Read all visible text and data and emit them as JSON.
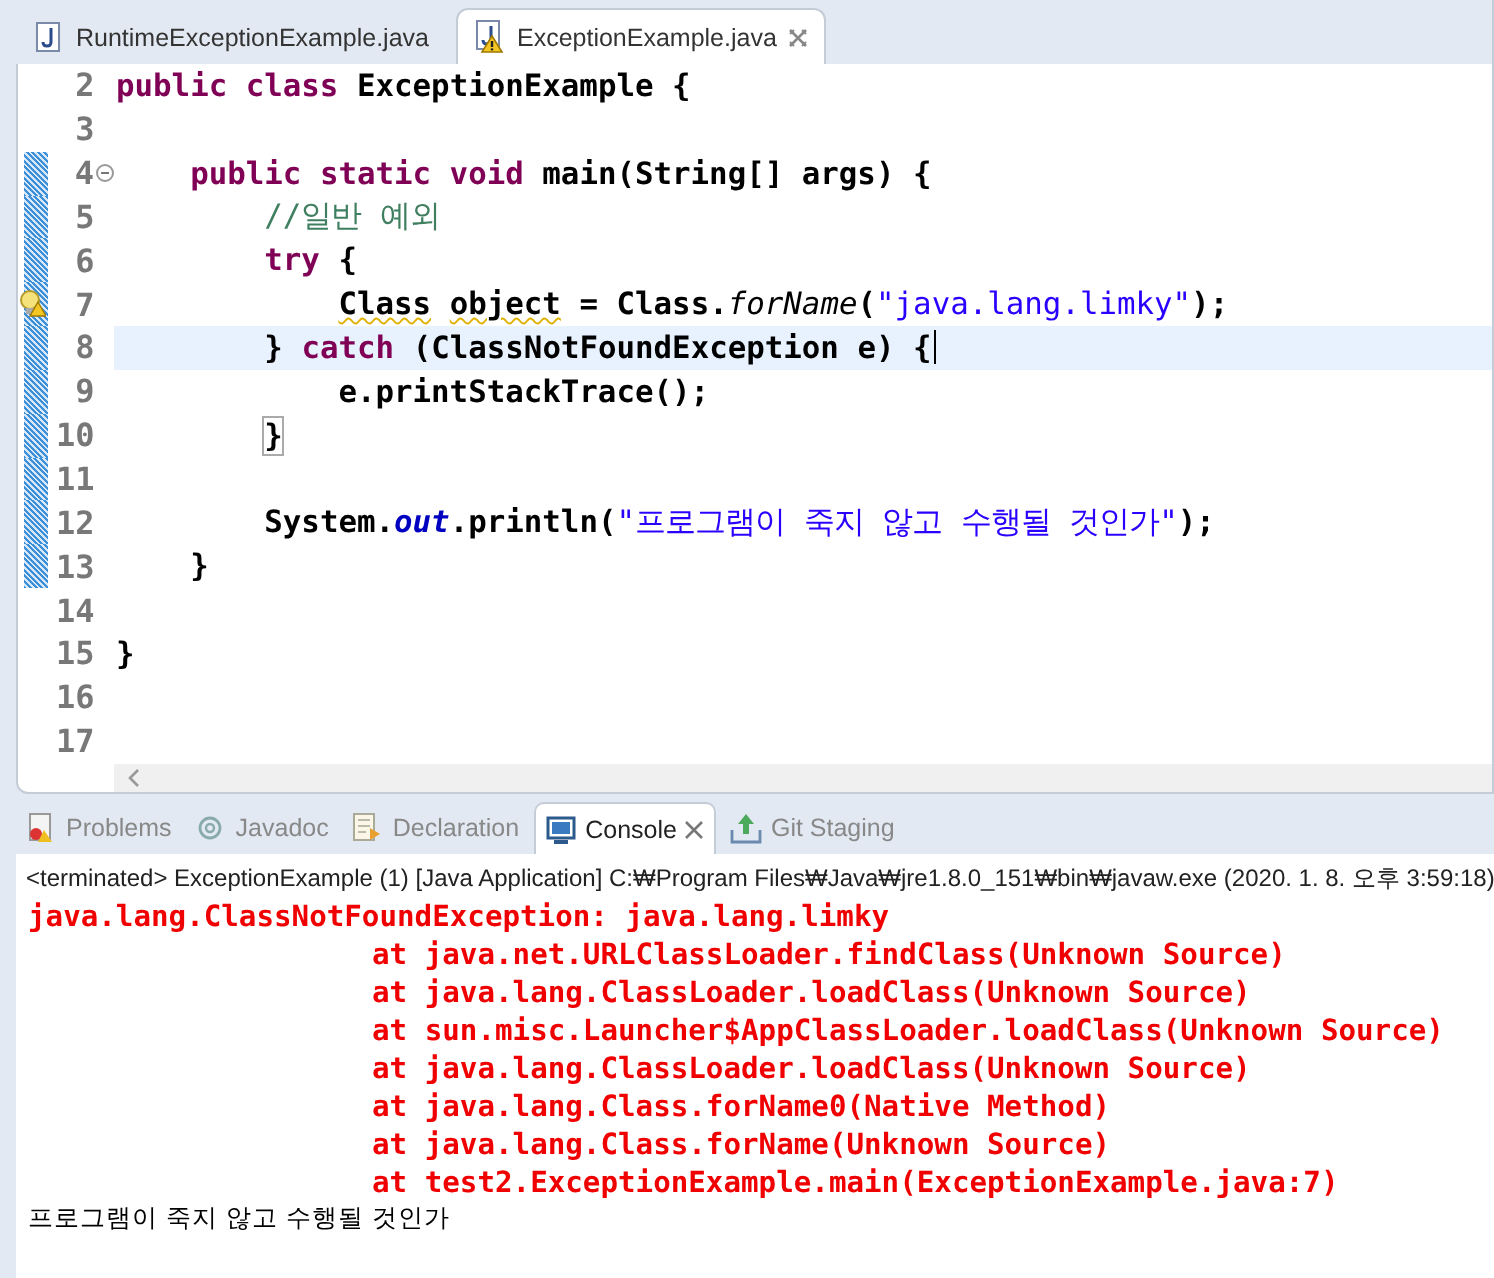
{
  "editor_tabs": [
    {
      "label": "RuntimeExceptionExample.java",
      "selected": false,
      "warning": false,
      "closable": false
    },
    {
      "label": "ExceptionExample.java",
      "selected": true,
      "warning": true,
      "closable": true
    }
  ],
  "code_lines": [
    {
      "number": "2",
      "changed": false,
      "current": false,
      "folding": false,
      "warning": false,
      "tokens": [
        {
          "kind": "keyword",
          "text": "public class "
        },
        {
          "kind": "plain",
          "text": "ExceptionExample {"
        }
      ]
    },
    {
      "number": "3",
      "changed": false,
      "current": false,
      "folding": false,
      "warning": false
    },
    {
      "number": "4",
      "changed": true,
      "current": false,
      "folding": true,
      "warning": false,
      "tokens": [
        {
          "kind": "keyword",
          "text": "    public static void "
        },
        {
          "kind": "plain",
          "text": "main(String[] args) {"
        }
      ]
    },
    {
      "number": "5",
      "changed": true,
      "current": false,
      "folding": false,
      "warning": false,
      "tokens": [
        {
          "kind": "comment",
          "text": "        //일반 예외"
        }
      ]
    },
    {
      "number": "6",
      "changed": true,
      "current": false,
      "folding": false,
      "warning": false,
      "tokens": [
        {
          "kind": "keyword",
          "text": "        try "
        },
        {
          "kind": "plain",
          "text": "{"
        }
      ]
    },
    {
      "number": "7",
      "changed": true,
      "current": false,
      "folding": false,
      "warning": true,
      "tokens": [
        {
          "kind": "warned",
          "text": "            Class "
        },
        {
          "kind": "warned",
          "text": "object"
        },
        {
          "kind": "plain",
          "text": " = Class."
        },
        {
          "kind": "static-method",
          "text": "forName"
        },
        {
          "kind": "plain",
          "text": "("
        },
        {
          "kind": "string",
          "text": "\"java.lang.limky\""
        },
        {
          "kind": "plain",
          "text": ");"
        }
      ]
    },
    {
      "number": "8",
      "changed": true,
      "current": true,
      "folding": false,
      "warning": false,
      "tokens": [
        {
          "kind": "plain",
          "text": "        } "
        },
        {
          "kind": "keyword",
          "text": "catch "
        },
        {
          "kind": "plain",
          "text": "(ClassNotFoundException e) {"
        }
      ]
    },
    {
      "number": "9",
      "changed": true,
      "current": false,
      "folding": false,
      "warning": false,
      "tokens": [
        {
          "kind": "plain",
          "text": "            e.printStackTrace();"
        }
      ]
    },
    {
      "number": "10",
      "changed": true,
      "current": false,
      "folding": false,
      "warning": false,
      "tokens": [
        {
          "kind": "matched-bracket",
          "text": "        }"
        }
      ]
    },
    {
      "number": "11",
      "changed": true,
      "current": false,
      "folding": false,
      "warning": false
    },
    {
      "number": "12",
      "changed": true,
      "current": false,
      "folding": false,
      "warning": false,
      "tokens": [
        {
          "kind": "plain",
          "text": "        System."
        },
        {
          "kind": "static-field",
          "text": "out"
        },
        {
          "kind": "plain",
          "text": ".println("
        },
        {
          "kind": "string",
          "text": "\"프로그램이 죽지 않고 수행될 것인가\""
        },
        {
          "kind": "plain",
          "text": ");"
        }
      ]
    },
    {
      "number": "13",
      "changed": true,
      "current": false,
      "folding": false,
      "warning": false,
      "tokens": [
        {
          "kind": "plain",
          "text": "    }"
        }
      ]
    },
    {
      "number": "14",
      "changed": false,
      "current": false,
      "folding": false,
      "warning": false
    },
    {
      "number": "15",
      "changed": false,
      "current": false,
      "folding": false,
      "warning": false,
      "tokens": [
        {
          "kind": "plain",
          "text": "}"
        }
      ]
    },
    {
      "number": "16",
      "changed": false,
      "current": false,
      "folding": false,
      "warning": false
    },
    {
      "number": "17",
      "changed": false,
      "current": false,
      "folding": false,
      "warning": false
    }
  ],
  "view_tabs": [
    {
      "label": "Problems",
      "kind": "problems",
      "selected": false,
      "closable": false
    },
    {
      "label": "Javadoc",
      "kind": "javadoc",
      "selected": false,
      "closable": false
    },
    {
      "label": "Declaration",
      "kind": "declaration",
      "selected": false,
      "closable": false
    },
    {
      "label": "Console",
      "kind": "console",
      "selected": true,
      "closable": true
    },
    {
      "label": "Git Staging",
      "kind": "git",
      "selected": false,
      "closable": false
    }
  ],
  "console": {
    "header": "<terminated> ExceptionExample (1) [Java Application] C:₩Program Files₩Java₩jre1.8.0_151₩bin₩javaw.exe (2020. 1. 8. 오후 3:59:18)",
    "lines": [
      {
        "kind": "error",
        "text": "java.lang.ClassNotFoundException: java.lang.limky"
      },
      {
        "kind": "stack",
        "text": "at java.net.URLClassLoader.findClass(Unknown Source)"
      },
      {
        "kind": "stack",
        "text": "at java.lang.ClassLoader.loadClass(Unknown Source)"
      },
      {
        "kind": "stack",
        "text": "at sun.misc.Launcher$AppClassLoader.loadClass(Unknown Source)"
      },
      {
        "kind": "stack",
        "text": "at java.lang.ClassLoader.loadClass(Unknown Source)"
      },
      {
        "kind": "stack",
        "text": "at java.lang.Class.forName0(Native Method)"
      },
      {
        "kind": "stack",
        "text": "at java.lang.Class.forName(Unknown Source)"
      },
      {
        "kind": "stack",
        "text": "at test2.ExceptionExample.main(ExceptionExample.java:7)"
      },
      {
        "kind": "output",
        "text": "프로그램이 죽지 않고 수행될 것인가"
      }
    ]
  }
}
